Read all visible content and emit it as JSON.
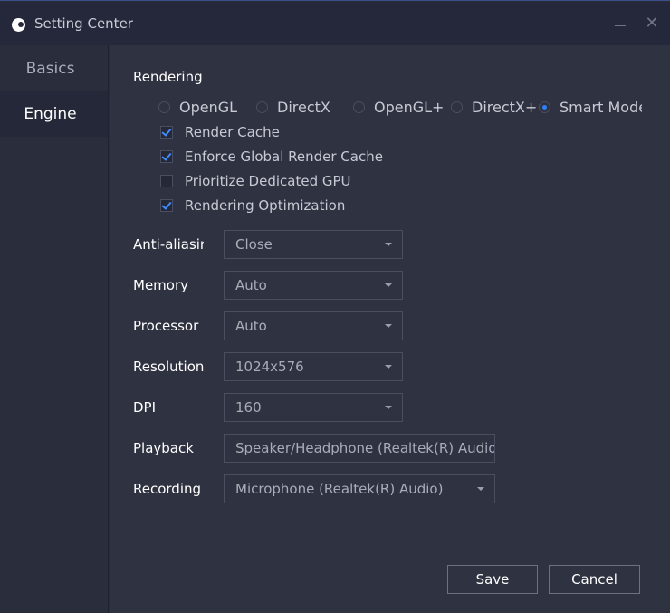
{
  "window": {
    "title": "Setting Center",
    "minimize_icon": "minimize-icon",
    "close_icon": "close-icon",
    "close_glyph": "✕"
  },
  "sidebar": {
    "items": [
      {
        "label": "Basics",
        "active": false
      },
      {
        "label": "Engine",
        "active": true
      }
    ]
  },
  "rendering": {
    "label": "Rendering",
    "modes": [
      {
        "label": "OpenGL",
        "selected": false
      },
      {
        "label": "DirectX",
        "selected": false
      },
      {
        "label": "OpenGL+",
        "selected": false
      },
      {
        "label": "DirectX+",
        "selected": false
      },
      {
        "label": "Smart Mode",
        "selected": true
      }
    ],
    "options": [
      {
        "label": "Render Cache",
        "checked": true
      },
      {
        "label": "Enforce Global Render Cache",
        "checked": true
      },
      {
        "label": "Prioritize Dedicated GPU",
        "checked": false
      },
      {
        "label": "Rendering Optimization",
        "checked": true
      }
    ]
  },
  "settings": [
    {
      "label": "Anti-aliasing",
      "value": "Close"
    },
    {
      "label": "Memory",
      "value": "Auto"
    },
    {
      "label": "Processor",
      "value": "Auto"
    },
    {
      "label": "Resolution",
      "value": "1024x576"
    },
    {
      "label": "DPI",
      "value": "160"
    },
    {
      "label": "Playback",
      "value": "Speaker/Headphone (Realtek(R) Audio)"
    },
    {
      "label": "Recording",
      "value": "Microphone (Realtek(R) Audio)"
    }
  ],
  "buttons": {
    "save": "Save",
    "cancel": "Cancel"
  },
  "colors": {
    "accent": "#2f7ff5",
    "background": "#2f3241",
    "sidebar": "#2a2d3b",
    "titlebar": "#25283a"
  }
}
